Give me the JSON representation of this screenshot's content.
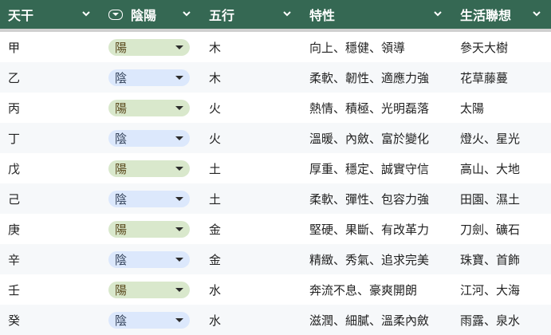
{
  "headers": [
    "天干",
    "陰陽",
    "五行",
    "特性",
    "生活聯想"
  ],
  "rows": [
    {
      "stem": "甲",
      "yinyang": "陽",
      "element": "木",
      "traits": "向上、穩健、領導",
      "assoc": "參天大樹"
    },
    {
      "stem": "乙",
      "yinyang": "陰",
      "element": "木",
      "traits": "柔軟、韌性、適應力強",
      "assoc": "花草藤蔓"
    },
    {
      "stem": "丙",
      "yinyang": "陽",
      "element": "火",
      "traits": "熱情、積極、光明磊落",
      "assoc": "太陽"
    },
    {
      "stem": "丁",
      "yinyang": "陰",
      "element": "火",
      "traits": "溫暖、內斂、富於變化",
      "assoc": "燈火、星光"
    },
    {
      "stem": "戊",
      "yinyang": "陽",
      "element": "土",
      "traits": "厚重、穩定、誠實守信",
      "assoc": "高山、大地"
    },
    {
      "stem": "己",
      "yinyang": "陰",
      "element": "土",
      "traits": "柔軟、彈性、包容力強",
      "assoc": "田園、濕土"
    },
    {
      "stem": "庚",
      "yinyang": "陽",
      "element": "金",
      "traits": "堅硬、果斷、有改革力",
      "assoc": "刀劍、礦石"
    },
    {
      "stem": "辛",
      "yinyang": "陰",
      "element": "金",
      "traits": "精緻、秀氣、追求完美",
      "assoc": "珠寶、首飾"
    },
    {
      "stem": "壬",
      "yinyang": "陽",
      "element": "水",
      "traits": "奔流不息、豪爽開朗",
      "assoc": "江河、大海"
    },
    {
      "stem": "癸",
      "yinyang": "陰",
      "element": "水",
      "traits": "滋潤、細膩、溫柔內斂",
      "assoc": "雨露、泉水"
    }
  ],
  "colors": {
    "header": "#356853",
    "yang_chip": "#d9e8cc",
    "yin_chip": "#dce8fc"
  }
}
